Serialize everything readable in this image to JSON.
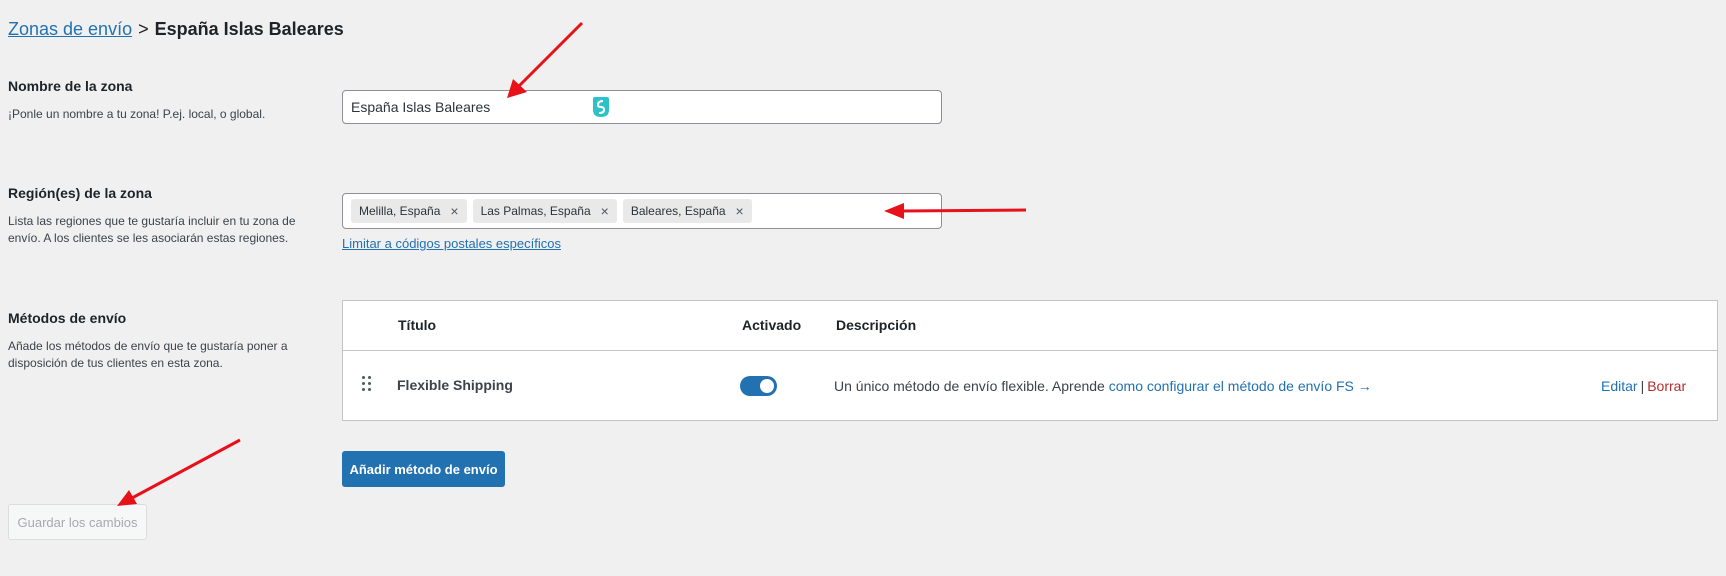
{
  "breadcrumb": {
    "parent": "Zonas de envío",
    "separator": ">",
    "current": "España Islas Baleares"
  },
  "zone_name": {
    "label": "Nombre de la zona",
    "help": "¡Ponle un nombre a tu zona! P.ej. local, o global.",
    "value": "España Islas Baleares"
  },
  "zone_regions": {
    "label": "Región(es) de la zona",
    "help": "Lista las regiones que te gustaría incluir en tu zona de envío. A los clientes se les asociarán estas regiones.",
    "chips": [
      {
        "label": "Melilla, España",
        "remove": "×"
      },
      {
        "label": "Las Palmas, España",
        "remove": "×"
      },
      {
        "label": "Baleares, España",
        "remove": "×"
      }
    ],
    "postal_link": "Limitar a códigos postales específicos"
  },
  "shipping_methods": {
    "label": "Métodos de envío",
    "help": "Añade los métodos de envío que te gustaría poner a disposición de tus clientes en esta zona.",
    "columns": {
      "title": "Título",
      "enabled": "Activado",
      "description": "Descripción"
    },
    "rows": [
      {
        "title": "Flexible Shipping",
        "enabled": true,
        "description": "Un único método de envío flexible. Aprende",
        "description_link": "como configurar el método de envío FS →",
        "edit": "Editar",
        "separator": "|",
        "delete": "Borrar"
      }
    ],
    "add_button": "Añadir método de envío"
  },
  "save_button": "Guardar los cambios",
  "colors": {
    "accent": "#2271b1",
    "delete": "#b32d2e",
    "annotation_arrow": "#e8111a"
  }
}
